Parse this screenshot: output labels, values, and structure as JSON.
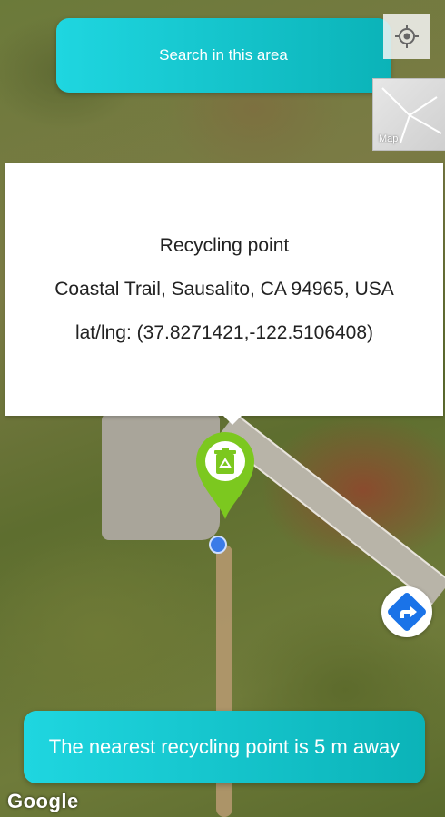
{
  "search_area": {
    "label": "Search in this area"
  },
  "locate": {
    "icon": "my-location-icon"
  },
  "map_type_toggle": {
    "label": "Map"
  },
  "info_card": {
    "title": "Recycling point",
    "address": "Coastal Trail, Sausalito, CA 94965, USA",
    "coords": "lat/lng: (37.8271421,-122.5106408)"
  },
  "marker": {
    "icon": "recycle-bin-icon",
    "color": "#7cc81f"
  },
  "directions": {
    "icon": "directions-icon",
    "color": "#1a73e8"
  },
  "nearest_banner": {
    "text": "The nearest recycling point is 5 m away"
  },
  "attribution": {
    "logo": "Google"
  },
  "colors": {
    "accent": "#1fd6e0",
    "accent_dark": "#0bb3b8"
  }
}
